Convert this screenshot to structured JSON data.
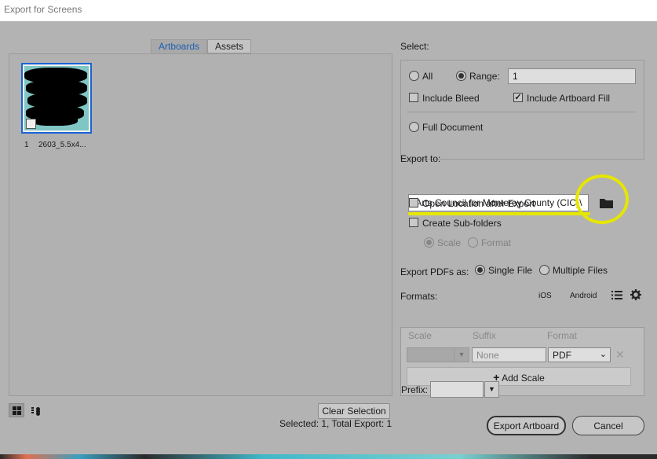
{
  "window": {
    "title": "Export for Screens"
  },
  "tabs": [
    {
      "label": "Artboards",
      "active": true
    },
    {
      "label": "Assets",
      "active": false
    }
  ],
  "artboards": [
    {
      "number": "1",
      "name": "2603_5.5x4...",
      "selected": true
    }
  ],
  "left_footer": {
    "clear_selection": "Clear Selection"
  },
  "select": {
    "label": "Select:",
    "all": "All",
    "range": "Range:",
    "range_value": "1",
    "include_bleed": "Include Bleed",
    "include_artboard_fill": "Include Artboard Fill",
    "full_document": "Full Document"
  },
  "export_to": {
    "label": "Export to:",
    "path": "\\Arts Council for Monterey County (CIC)\\",
    "open_location": "Open Location after Export",
    "create_subfolders": "Create Sub-folders",
    "scale": "Scale",
    "format": "Format"
  },
  "export_pdfs": {
    "label": "Export PDFs as:",
    "single_file": "Single File",
    "multiple_files": "Multiple Files"
  },
  "formats": {
    "label": "Formats:",
    "ios": "iOS",
    "android": "Android",
    "columns": {
      "scale": "Scale",
      "suffix": "Suffix",
      "format": "Format"
    },
    "row": {
      "suffix_placeholder": "None",
      "format": "PDF"
    },
    "add_scale": "Add Scale"
  },
  "prefix": {
    "label": "Prefix:"
  },
  "status": "Selected: 1, Total Export: 1",
  "buttons": {
    "export": "Export Artboard",
    "cancel": "Cancel"
  },
  "colors": {
    "accent": "#1a64d6",
    "annotation": "#e6e600",
    "dialog_bg": "#b3b3b3"
  }
}
